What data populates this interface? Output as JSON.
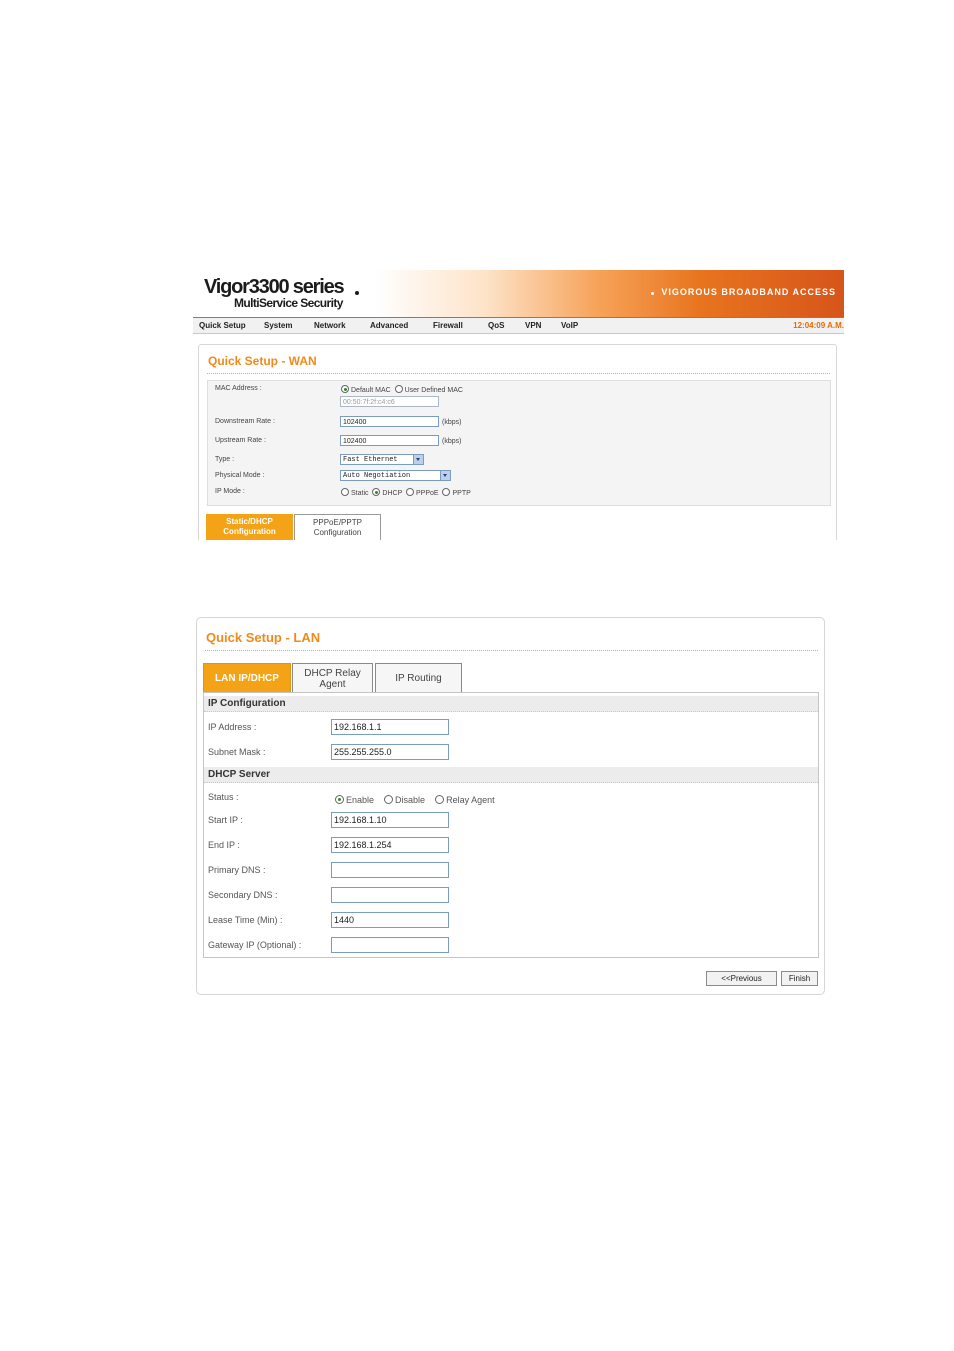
{
  "wan": {
    "brand": {
      "title": "Vigor3300 series",
      "subtitle": "MultiService Security",
      "slogan": "VIGOROUS BROADBAND ACCESS"
    },
    "menu": [
      "Quick Setup",
      "System",
      "Network",
      "Advanced",
      "Firewall",
      "QoS",
      "VPN",
      "VoIP"
    ],
    "clock": "12:04:09 A.M.",
    "title": "Quick Setup - WAN",
    "fields": {
      "mac_label": "MAC Address :",
      "mac_default": "Default MAC",
      "mac_user": "User Defined MAC",
      "mac_value": "00:50:7f:2f:c4:c6",
      "down_label": "Downstream Rate :",
      "down_value": "102400",
      "down_unit": "(kbps)",
      "up_label": "Upstream Rate :",
      "up_value": "102400",
      "up_unit": "(kbps)",
      "type_label": "Type :",
      "type_value": "Fast Ethernet",
      "phys_label": "Physical Mode :",
      "phys_value": "Auto Negotiation",
      "ipmode_label": "IP Mode :",
      "ipmode_options": [
        "Static",
        "DHCP",
        "PPPoE",
        "PPTP"
      ],
      "ipmode_selected": "DHCP"
    },
    "tabs": [
      {
        "line1": "Static/DHCP",
        "line2": "Configuration"
      },
      {
        "line1": "PPPoE/PPTP",
        "line2": "Configuration"
      }
    ]
  },
  "lan": {
    "title": "Quick Setup - LAN",
    "tabs": [
      {
        "line1": "LAN IP/DHCP",
        "line2": ""
      },
      {
        "line1": "DHCP Relay",
        "line2": "Agent"
      },
      {
        "line1": "IP Routing",
        "line2": ""
      }
    ],
    "ip_section": "IP Configuration",
    "ip_address_label": "IP Address :",
    "ip_address_value": "192.168.1.1",
    "subnet_label": "Subnet Mask :",
    "subnet_value": "255.255.255.0",
    "dhcp_section": "DHCP Server",
    "status_label": "Status :",
    "status_options": [
      "Enable",
      "Disable",
      "Relay Agent"
    ],
    "status_selected": "Enable",
    "start_ip_label": "Start IP :",
    "start_ip_value": "192.168.1.10",
    "end_ip_label": "End IP :",
    "end_ip_value": "192.168.1.254",
    "primary_dns_label": "Primary DNS :",
    "primary_dns_value": "",
    "secondary_dns_label": "Secondary DNS :",
    "secondary_dns_value": "",
    "lease_label": "Lease Time (Min) :",
    "lease_value": "1440",
    "gateway_label": "Gateway IP (Optional) :",
    "gateway_value": "",
    "prev_button": "<<Previous",
    "finish_button": "Finish"
  }
}
